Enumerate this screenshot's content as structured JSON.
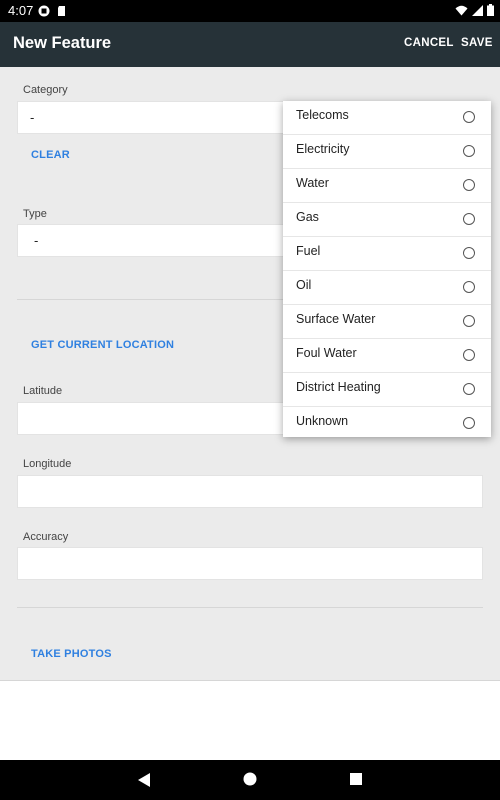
{
  "status_bar": {
    "time": "4:07"
  },
  "app_bar": {
    "title": "New Feature",
    "cancel_label": "CANCEL",
    "save_label": "SAVE"
  },
  "form": {
    "category": {
      "label": "Category",
      "value": "-",
      "clear_label": "CLEAR"
    },
    "type": {
      "label": "Type",
      "value": "-"
    },
    "location_button": "GET CURRENT LOCATION",
    "latitude": {
      "label": "Latitude",
      "value": ""
    },
    "longitude": {
      "label": "Longitude",
      "value": ""
    },
    "accuracy": {
      "label": "Accuracy",
      "value": ""
    },
    "photos_button": "TAKE PHOTOS"
  },
  "popup": {
    "options": [
      "Telecoms",
      "Electricity",
      "Water",
      "Gas",
      "Fuel",
      "Oil",
      "Surface Water",
      "Foul Water",
      "District Heating",
      "Unknown"
    ]
  },
  "colors": {
    "app_bar": "#263238",
    "accent": "#2f80e0",
    "background": "#ebebeb"
  }
}
